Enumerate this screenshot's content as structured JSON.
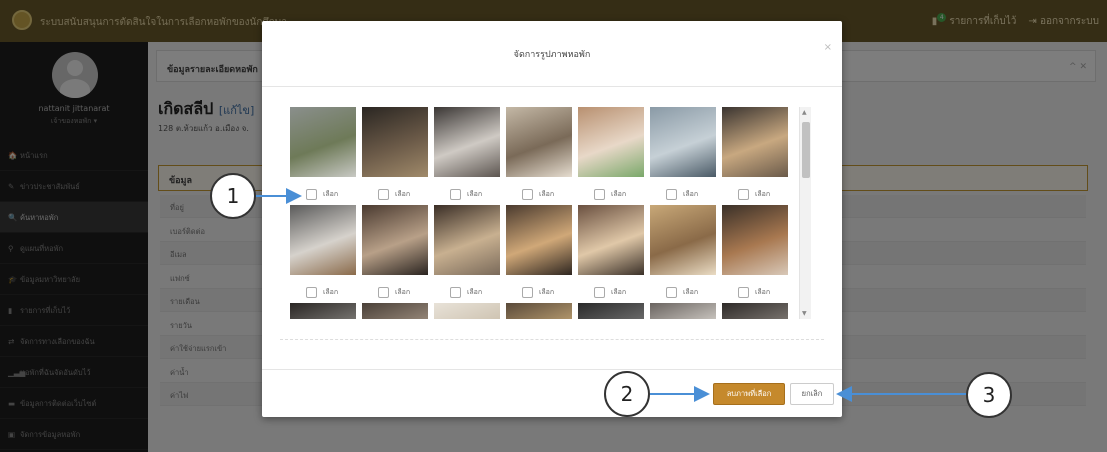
{
  "topbar": {
    "app_title": "ระบบสนับสนุนการตัดสินใจในการเลือกหอพักของนักศึกษา",
    "saved_count": "4",
    "saved_label": "รายการที่เก็บไว้",
    "logout_label": "ออกจากระบบ"
  },
  "sidebar": {
    "user_name": "nattanit jittanarat",
    "user_role": "เจ้าของหอพัก ▾",
    "items": [
      {
        "icon": "home-icon",
        "glyph": "🏠",
        "label": "หน้าแรก"
      },
      {
        "icon": "megaphone-icon",
        "glyph": "✎",
        "label": "ข่าวประชาสัมพันธ์"
      },
      {
        "icon": "search-icon",
        "glyph": "🔍",
        "label": "ค้นหาหอพัก"
      },
      {
        "icon": "map-pin-icon",
        "glyph": "⚲",
        "label": "ดูแผนที่หอพัก"
      },
      {
        "icon": "graduation-icon",
        "glyph": "🎓",
        "label": "ข้อมูลมหาวิทยาลัย"
      },
      {
        "icon": "bookmark-icon",
        "glyph": "▮",
        "label": "รายการที่เก็บไว้"
      },
      {
        "icon": "swap-icon",
        "glyph": "⇄",
        "label": "จัดการทางเลือกของฉัน"
      },
      {
        "icon": "bar-chart-icon",
        "glyph": "▁▃▅",
        "label": "หอพักที่ฉันจัดอันดับไว้"
      },
      {
        "icon": "comment-icon",
        "glyph": "▬",
        "label": "ข้อมูลการติดต่อเว็บไซต์"
      },
      {
        "icon": "building-icon",
        "glyph": "▣",
        "label": "จัดการข้อมูลหอพัก"
      }
    ]
  },
  "content": {
    "panel_title": "ข้อมูลรายละเอียดหอพัก",
    "panel_controls": "^ ✕",
    "dorm_name": "เกิดสลีป",
    "edit_link": "[แก้ไข]",
    "address": "128 ต.ห้วยแก้ว อ.เมือง จ.",
    "info_header": "ข้อมูล",
    "row_labels": [
      "ที่อยู่",
      "เบอร์ติดต่อ",
      "อีเมล",
      "แฟกซ์",
      "รายเดือน",
      "รายวัน",
      "ค่าใช้จ่ายแรกเข้า",
      "ค่าน้ำ",
      "ค่าไฟ"
    ]
  },
  "modal": {
    "title": "จัดการรูปภาพหอพัก",
    "close_glyph": "×",
    "select_label": "เลือก",
    "save_button": "ลบภาพที่เลือก",
    "cancel_button": "ยกเลิก",
    "scroll_up": "▲",
    "scroll_down": "▼"
  },
  "callouts": [
    "1",
    "2",
    "3"
  ],
  "colors": {
    "topbar": "#6b5a2a",
    "sidebar": "#1e1e1e",
    "accent": "#c5892c",
    "callout_arrow": "#4a8fd6"
  }
}
